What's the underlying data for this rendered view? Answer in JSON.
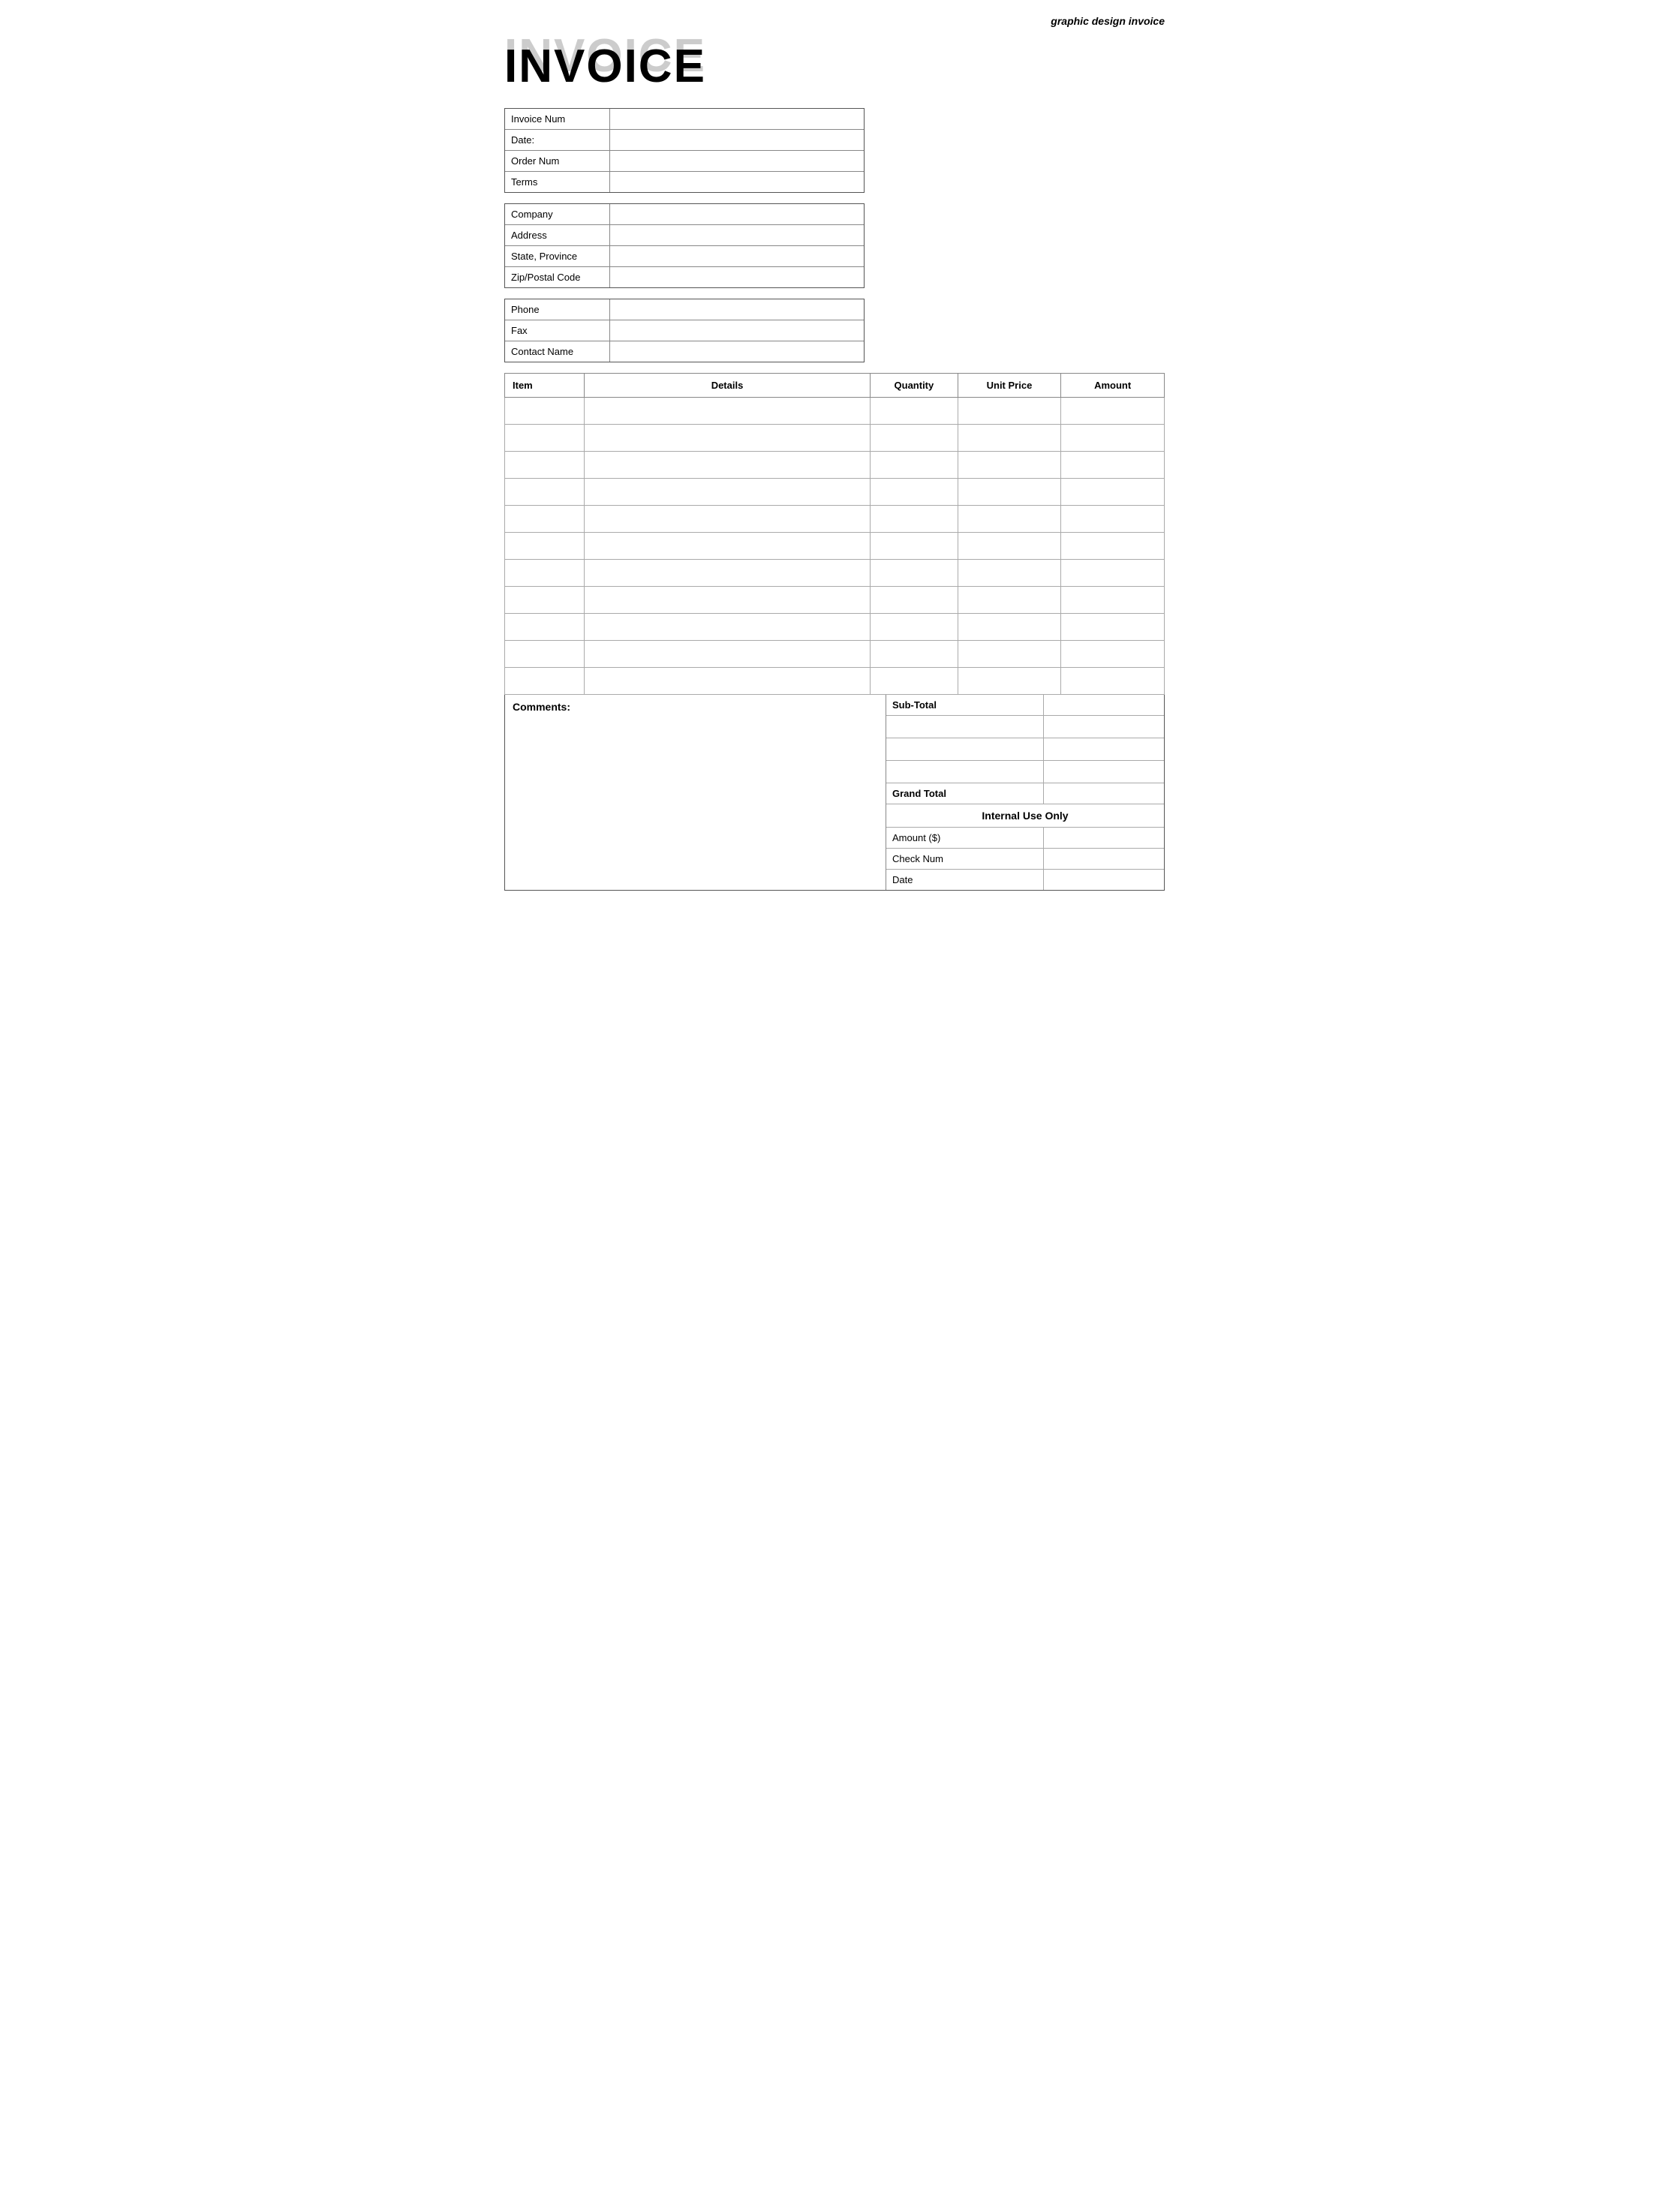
{
  "header": {
    "title": "graphic design invoice"
  },
  "invoice_title": {
    "shadow": "INVOICE",
    "main": "INVOICE"
  },
  "invoice_info": {
    "rows": [
      {
        "label": "Invoice Num",
        "value": ""
      },
      {
        "label": "Date:",
        "value": ""
      },
      {
        "label": "Order Num",
        "value": ""
      },
      {
        "label": "Terms",
        "value": ""
      }
    ]
  },
  "company_info": {
    "rows": [
      {
        "label": "Company",
        "value": ""
      },
      {
        "label": "Address",
        "value": ""
      },
      {
        "label": "State, Province",
        "value": ""
      },
      {
        "label": "Zip/Postal Code",
        "value": ""
      }
    ]
  },
  "contact_info": {
    "rows": [
      {
        "label": "Phone",
        "value": ""
      },
      {
        "label": "Fax",
        "value": ""
      },
      {
        "label": "Contact Name",
        "value": ""
      }
    ]
  },
  "table": {
    "headers": {
      "item": "Item",
      "details": "Details",
      "quantity": "Quantity",
      "unit_price": "Unit Price",
      "amount": "Amount"
    },
    "rows": [
      {
        "item": "",
        "details": "",
        "quantity": "",
        "unit_price": "",
        "amount": ""
      },
      {
        "item": "",
        "details": "",
        "quantity": "",
        "unit_price": "",
        "amount": ""
      },
      {
        "item": "",
        "details": "",
        "quantity": "",
        "unit_price": "",
        "amount": ""
      },
      {
        "item": "",
        "details": "",
        "quantity": "",
        "unit_price": "",
        "amount": ""
      },
      {
        "item": "",
        "details": "",
        "quantity": "",
        "unit_price": "",
        "amount": ""
      },
      {
        "item": "",
        "details": "",
        "quantity": "",
        "unit_price": "",
        "amount": ""
      },
      {
        "item": "",
        "details": "",
        "quantity": "",
        "unit_price": "",
        "amount": ""
      },
      {
        "item": "",
        "details": "",
        "quantity": "",
        "unit_price": "",
        "amount": ""
      },
      {
        "item": "",
        "details": "",
        "quantity": "",
        "unit_price": "",
        "amount": ""
      },
      {
        "item": "",
        "details": "",
        "quantity": "",
        "unit_price": "",
        "amount": ""
      },
      {
        "item": "",
        "details": "",
        "quantity": "",
        "unit_price": "",
        "amount": ""
      }
    ]
  },
  "comments": {
    "label": "Comments:"
  },
  "totals": {
    "subtotal_label": "Sub-Total",
    "empty_rows": 4,
    "grand_total_label": "Grand Total",
    "internal_use_label": "Internal Use Only",
    "detail_rows": [
      {
        "label": "Amount ($)",
        "value": ""
      },
      {
        "label": "Check Num",
        "value": ""
      },
      {
        "label": "Date",
        "value": ""
      }
    ]
  }
}
